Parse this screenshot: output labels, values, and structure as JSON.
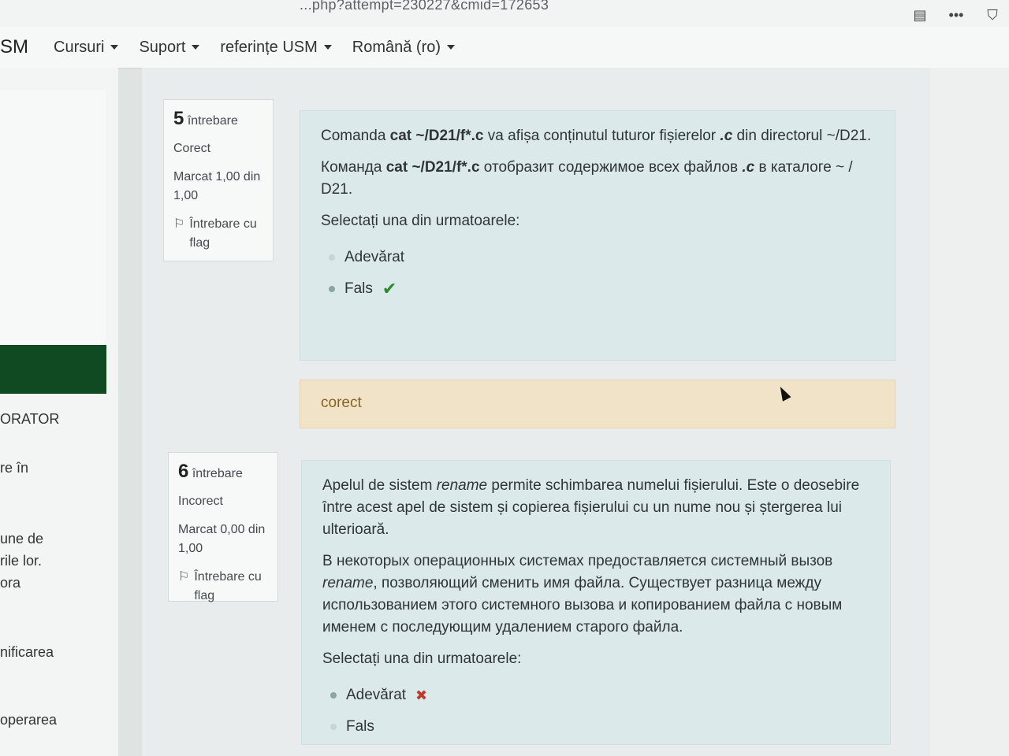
{
  "browser": {
    "url": "...php?attempt=230227&cmid=172653"
  },
  "navbar": {
    "brand": "SM",
    "items": [
      {
        "label": "Cursuri"
      },
      {
        "label": "Suport"
      },
      {
        "label": "referințe USM"
      },
      {
        "label": "Română (ro)"
      }
    ]
  },
  "drawer": {
    "labels": [
      "ORATOR",
      "re în",
      "une de",
      "rile lor.",
      "ora",
      "nificarea",
      "operarea"
    ]
  },
  "questions": [
    {
      "number": "5",
      "word": "întrebare",
      "status": "Corect",
      "mark": "Marcat 1,00 din 1,00",
      "flag": "Întrebare cu flag",
      "text_ro_pre": "Comanda ",
      "text_ro_cmd": "cat  ~/D21/f*.c",
      "text_ro_mid": "  va afișa conținutul tuturor fișierelor ",
      "text_ro_ext": ".c",
      "text_ro_post": " din directorul ~/D21.",
      "text_ru_pre": "Команда ",
      "text_ru_cmd": "cat  ~/D21/f*.c",
      "text_ru_mid": "  отобразит содержимое всех файлов ",
      "text_ru_ext": ".c",
      "text_ru_post": " в каталоге ~ / D21.",
      "prompt": "Selectați una din urmatoarele:",
      "options": [
        {
          "label": "Adevărat"
        },
        {
          "label": "Fals"
        }
      ],
      "feedback": "corect"
    },
    {
      "number": "6",
      "word": "întrebare",
      "status": "Incorect",
      "mark": "Marcat 0,00 din 1,00",
      "flag": "Întrebare cu flag",
      "text_ro_pre": "Apelul de sistem ",
      "text_ro_em": "rename",
      "text_ro_post": " permite schimbarea numelui fișierului. Este o deosebire între acest apel de sistem și copierea fișierului cu un nume nou și ștergerea lui ulterioară.",
      "text_ru_pre": "В некоторых операционных системах предоставляется системный вызов ",
      "text_ru_em": "rename",
      "text_ru_post": ", позволяющий сменить имя файла. Существует разница между использованием этого системного вызова и копированием файла с новым именем с последующим удалением старого файла.",
      "prompt": "Selectați una din urmatoarele:",
      "options": [
        {
          "label": "Adevărat"
        },
        {
          "label": "Fals"
        }
      ]
    }
  ]
}
